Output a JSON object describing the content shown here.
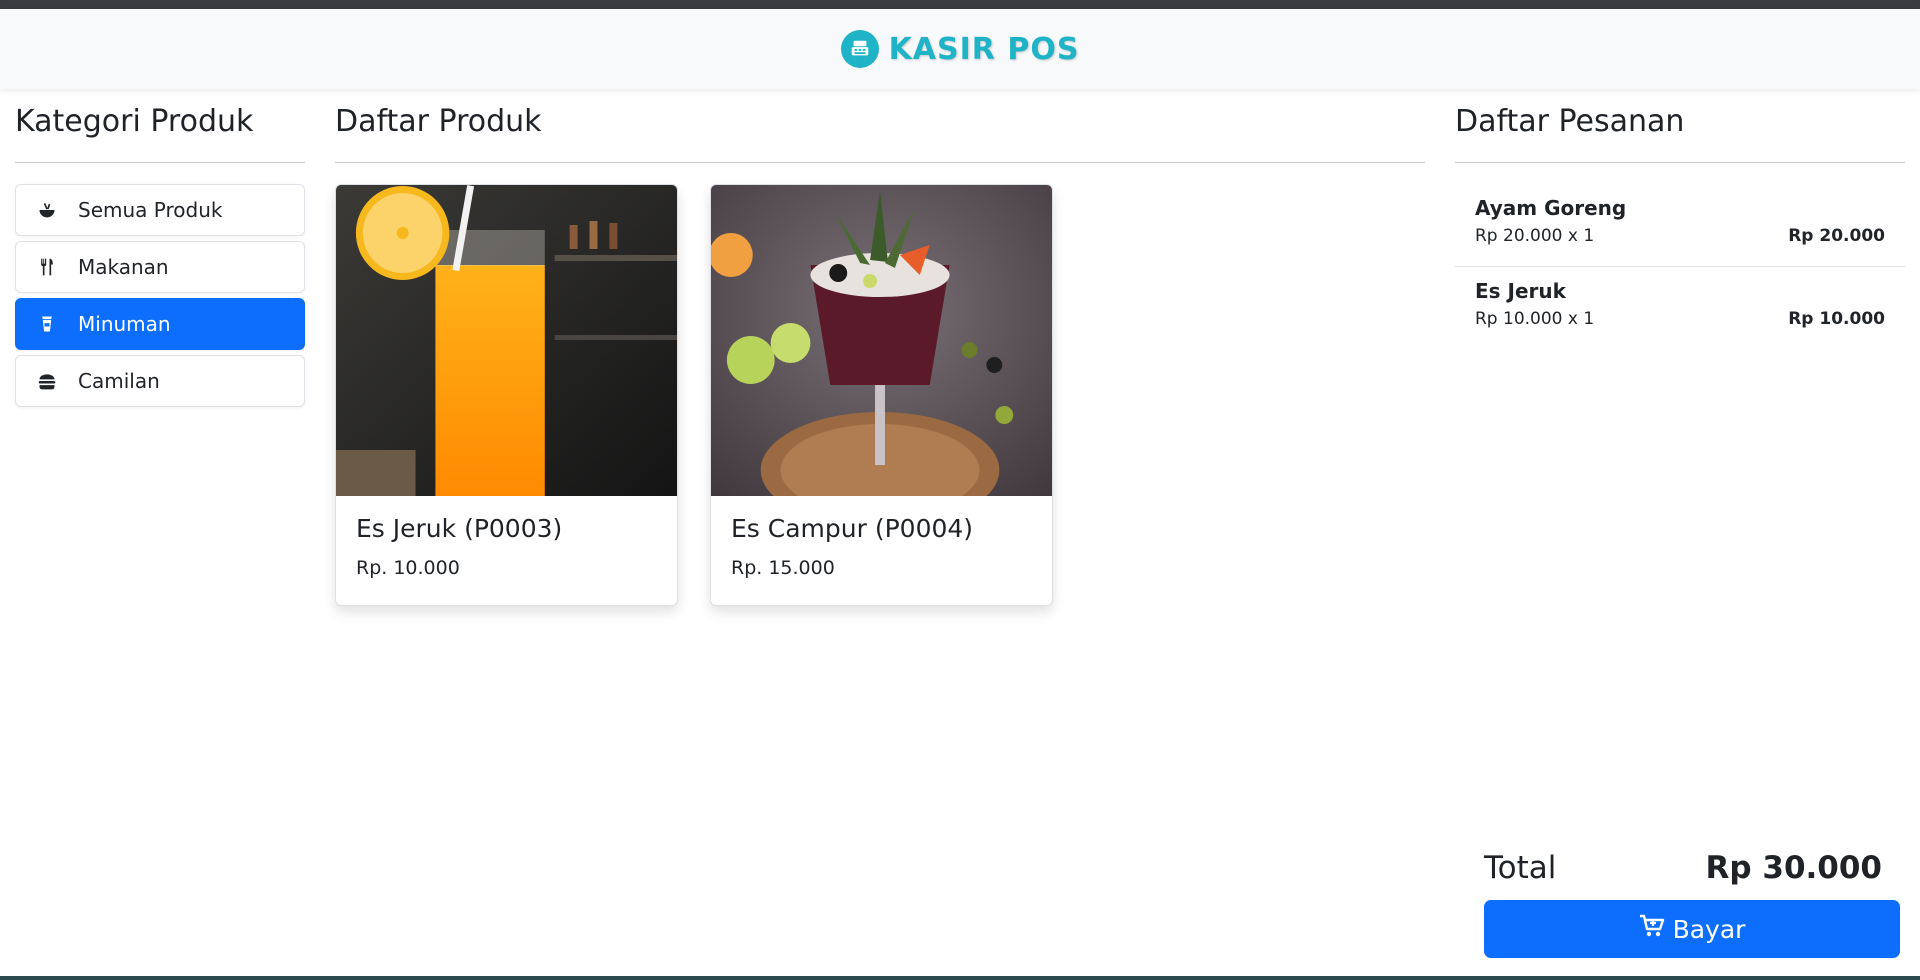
{
  "header": {
    "brand": "KASIR POS",
    "logo_icon": "cash-register-icon",
    "accent": "#1fb3c8"
  },
  "categories": {
    "title": "Kategori Produk",
    "items": [
      {
        "label": "Semua Produk",
        "icon": "bowl-food-icon",
        "active": false
      },
      {
        "label": "Makanan",
        "icon": "utensils-icon",
        "active": false
      },
      {
        "label": "Minuman",
        "icon": "cup-icon",
        "active": true
      },
      {
        "label": "Camilan",
        "icon": "burger-icon",
        "active": false
      }
    ]
  },
  "products": {
    "title": "Daftar Produk",
    "items": [
      {
        "name": "Es Jeruk (P0003)",
        "price": "Rp. 10.000",
        "image": "orange-juice-photo"
      },
      {
        "name": "Es Campur (P0004)",
        "price": "Rp. 15.000",
        "image": "cocktail-photo"
      }
    ]
  },
  "orders": {
    "title": "Daftar Pesanan",
    "items": [
      {
        "name": "Ayam Goreng",
        "qty_line": "Rp 20.000 x 1",
        "subtotal": "Rp 20.000"
      },
      {
        "name": "Es Jeruk",
        "qty_line": "Rp 10.000 x 1",
        "subtotal": "Rp 10.000"
      }
    ],
    "total_label": "Total",
    "total_value": "Rp 30.000",
    "pay_label": "Bayar",
    "pay_icon": "cart-plus-icon"
  },
  "colors": {
    "primary": "#0d6efd",
    "brand": "#1fb3c8"
  }
}
